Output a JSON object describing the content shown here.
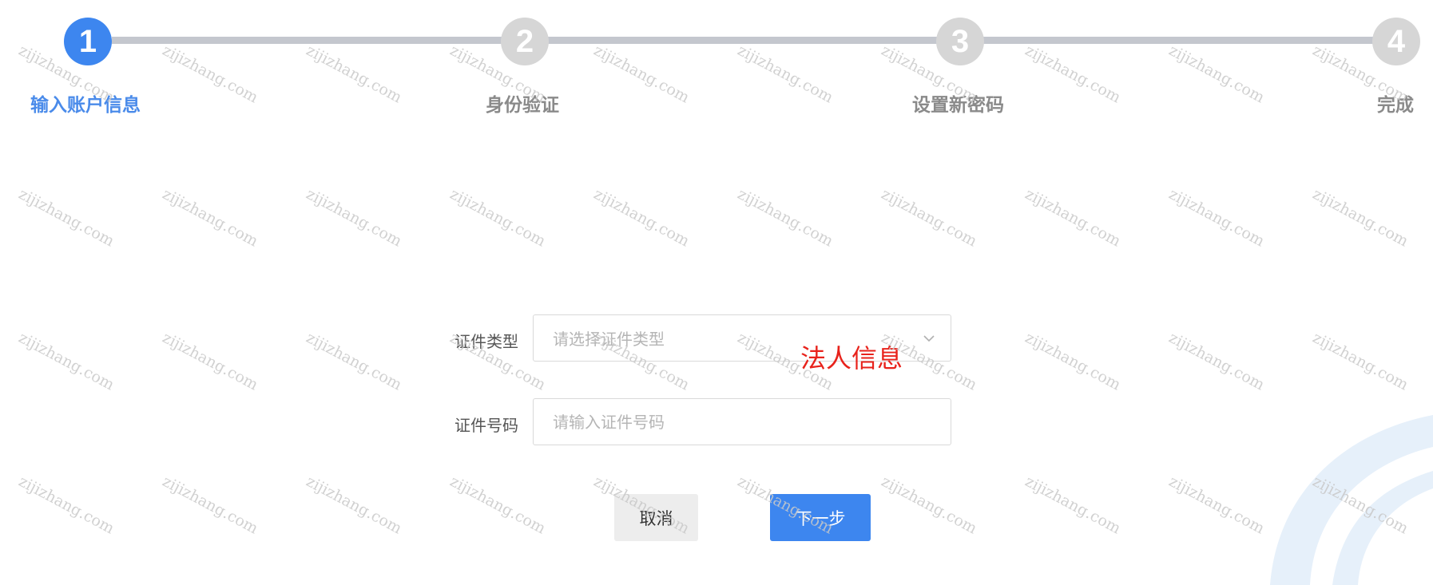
{
  "steps": [
    {
      "number": "1",
      "label": "输入账户信息",
      "state": "active"
    },
    {
      "number": "2",
      "label": "身份验证",
      "state": "inactive"
    },
    {
      "number": "3",
      "label": "设置新密码",
      "state": "inactive"
    },
    {
      "number": "4",
      "label": "完成",
      "state": "inactive"
    }
  ],
  "form": {
    "id_type": {
      "label": "证件类型",
      "placeholder": "请选择证件类型"
    },
    "id_number": {
      "label": "证件号码",
      "placeholder": "请输入证件号码"
    }
  },
  "annotation": "法人信息",
  "buttons": {
    "cancel": "取消",
    "next": "下一步"
  },
  "watermark_text": "zijizhang.com",
  "colors": {
    "accent": "#3d86ef",
    "active_label": "#4a8bea",
    "inactive_step": "#d6d6d6",
    "annotation": "#e8221b"
  }
}
